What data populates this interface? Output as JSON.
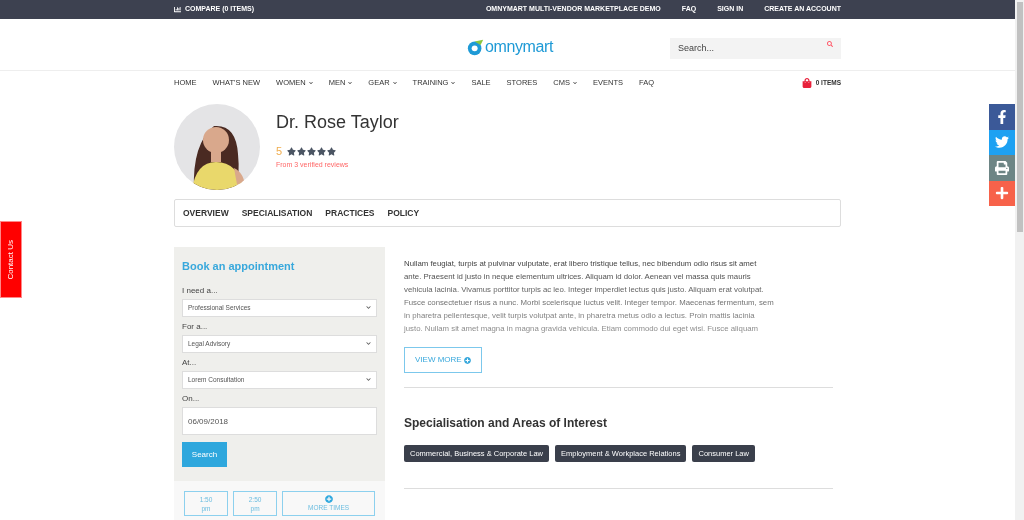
{
  "top_bar": {
    "compare": "COMPARE (0 ITEMS)",
    "links": [
      "OMNYMART MULTI-VENDOR MARKETPLACE DEMO",
      "FAQ",
      "SIGN IN",
      "CREATE AN ACCOUNT"
    ]
  },
  "header": {
    "logo": "omnymart",
    "search": {
      "placeholder": "Search..."
    }
  },
  "nav": {
    "items": [
      {
        "label": "HOME",
        "dropdown": false
      },
      {
        "label": "WHAT'S NEW",
        "dropdown": false
      },
      {
        "label": "WOMEN",
        "dropdown": true
      },
      {
        "label": "MEN",
        "dropdown": true
      },
      {
        "label": "GEAR",
        "dropdown": true
      },
      {
        "label": "TRAINING",
        "dropdown": true
      },
      {
        "label": "SALE",
        "dropdown": false
      },
      {
        "label": "STORES",
        "dropdown": false
      },
      {
        "label": "CMS",
        "dropdown": true
      },
      {
        "label": "EVENTS",
        "dropdown": false
      },
      {
        "label": "FAQ",
        "dropdown": false
      }
    ],
    "cart": "0 ITEMS"
  },
  "profile": {
    "name": "Dr. Rose Taylor",
    "rating": "5",
    "stars": 5,
    "reviews": "From 3 verified reviews"
  },
  "tabs": [
    {
      "label": "OVERVIEW"
    },
    {
      "label": "SPECIALISATION"
    },
    {
      "label": "PRACTICES"
    },
    {
      "label": "POLICY"
    }
  ],
  "booking": {
    "title": "Book an appointment",
    "fields": [
      {
        "kind": "select",
        "label": "I need a...",
        "value": "Professional Services"
      },
      {
        "kind": "select",
        "label": "For a...",
        "value": "Legal Advisory"
      },
      {
        "kind": "select",
        "label": "At...",
        "value": "Lorem Consultation"
      },
      {
        "kind": "input",
        "label": "On...",
        "value": "06/09/2018"
      }
    ],
    "button": "Search",
    "times": [
      {
        "kind": "time",
        "hour": "1:50",
        "period": "pm"
      },
      {
        "kind": "time",
        "hour": "2:50",
        "period": "pm"
      },
      {
        "kind": "more",
        "label": "MORE TIMES"
      }
    ]
  },
  "overview": {
    "lines": [
      "Nullam feugiat, turpis at pulvinar vulputate, erat libero tristique tellus, nec bibendum odio risus sit amet",
      "ante. Praesent id justo in neque elementum ultrices. Aliquam id dolor. Aenean vel massa quis mauris",
      "vehicula lacinia. Vivamus porttitor turpis ac leo. Integer imperdiet lectus quis justo. Aliquam erat volutpat.",
      "Fusce consectetuer risus a nunc. Morbi scelerisque luctus velit. Integer tempor. Maecenas fermentum, sem",
      "in pharetra pellentesque, velit turpis volutpat ante, in pharetra metus odio a lectus. Proin mattis lacinia",
      "justo. Nullam sit amet magna in magna gravida vehicula. Etiam commodo dui eget wisi. Fusce aliquam"
    ],
    "button": "VIEW MORE"
  },
  "specialisation": {
    "title": "Specialisation and Areas of Interest",
    "tags": [
      "Commercial, Business & Corporate Law",
      "Employment & Workplace Relations",
      "Consumer Law"
    ]
  },
  "share": [
    {
      "kind": "facebook",
      "color": "#3b5998"
    },
    {
      "kind": "twitter",
      "color": "#1da1f2"
    },
    {
      "kind": "print",
      "color": "#6d8585"
    },
    {
      "kind": "more",
      "color": "#f7624a"
    }
  ],
  "contact_tab": "Contact Us"
}
